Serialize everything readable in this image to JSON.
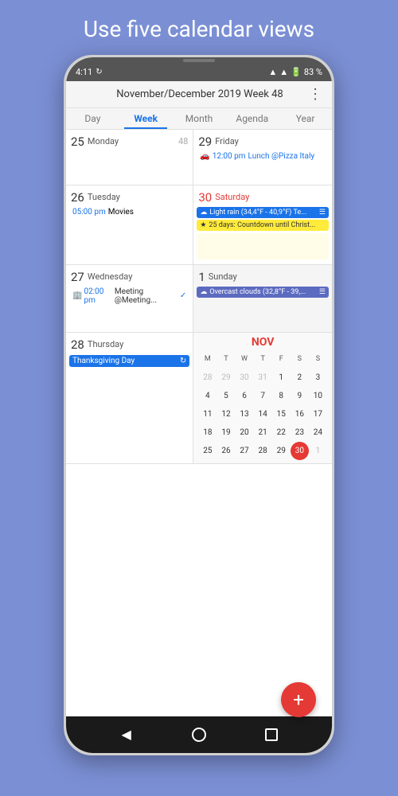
{
  "headline": "Use five calendar views",
  "statusBar": {
    "time": "4:11",
    "battery": "83 %"
  },
  "appHeader": {
    "title": "November/December 2019 Week 48",
    "menuIcon": "⋮"
  },
  "navTabs": [
    {
      "label": "Day",
      "active": false
    },
    {
      "label": "Week",
      "active": true
    },
    {
      "label": "Month",
      "active": false
    },
    {
      "label": "Agenda",
      "active": false
    },
    {
      "label": "Year",
      "active": false
    }
  ],
  "weekRows": [
    {
      "left": {
        "dayNum": "25",
        "dayName": "Monday",
        "weekNum": "48",
        "events": []
      },
      "right": {
        "dayNum": "29",
        "dayName": "Friday",
        "events": [
          {
            "type": "lunch",
            "time": "12:00 pm",
            "desc": "Lunch @Pizza Italy",
            "icon": "🚗"
          }
        ]
      }
    },
    {
      "left": {
        "dayNum": "26",
        "dayName": "Tuesday",
        "events": [
          {
            "type": "time-event",
            "time": "05:00 pm",
            "desc": "Movies"
          }
        ]
      },
      "right": {
        "dayNum": "30",
        "dayName": "Saturday",
        "isSaturday": true,
        "events": [
          {
            "type": "blue-bar",
            "icon": "☁",
            "desc": "Light rain (34,4°F - 40,9°F) Te..."
          },
          {
            "type": "star-bar",
            "icon": "★",
            "desc": "25 days: Countdown until Christ..."
          }
        ]
      }
    },
    {
      "left": {
        "dayNum": "27",
        "dayName": "Wednesday",
        "events": [
          {
            "type": "meet",
            "time": "02:00 pm",
            "desc": "Meeting @Meeting...",
            "icon": "🏢"
          }
        ]
      },
      "right": {
        "dayNum": "1",
        "dayName": "Sunday",
        "events": [
          {
            "type": "overcast",
            "icon": "☁",
            "desc": "Overcast clouds (32,8°F - 39,..."
          }
        ]
      }
    }
  ],
  "thursdayRow": {
    "dayNum": "28",
    "dayName": "Thursday",
    "event": "Thanksgiving Day"
  },
  "miniCal": {
    "month": "NOV",
    "headers": [
      "M",
      "T",
      "W",
      "T",
      "F",
      "S",
      "S"
    ],
    "rows": [
      [
        {
          "label": "28",
          "muted": true
        },
        {
          "label": "29",
          "muted": true
        },
        {
          "label": "30",
          "muted": true
        },
        {
          "label": "31",
          "muted": true
        },
        {
          "label": "1"
        },
        {
          "label": "2"
        },
        {
          "label": "3"
        }
      ],
      [
        {
          "label": "4"
        },
        {
          "label": "5"
        },
        {
          "label": "6"
        },
        {
          "label": "7"
        },
        {
          "label": "8"
        },
        {
          "label": "9"
        },
        {
          "label": "10"
        }
      ],
      [
        {
          "label": "11"
        },
        {
          "label": "12"
        },
        {
          "label": "13"
        },
        {
          "label": "14"
        },
        {
          "label": "15"
        },
        {
          "label": "16"
        },
        {
          "label": "17"
        }
      ],
      [
        {
          "label": "18"
        },
        {
          "label": "19"
        },
        {
          "label": "20"
        },
        {
          "label": "21"
        },
        {
          "label": "22"
        },
        {
          "label": "23"
        },
        {
          "label": "24"
        }
      ],
      [
        {
          "label": "25"
        },
        {
          "label": "26"
        },
        {
          "label": "27"
        },
        {
          "label": "28"
        },
        {
          "label": "29"
        },
        {
          "label": "30",
          "today": true
        },
        {
          "label": "1",
          "muted": true
        }
      ]
    ]
  },
  "fab": "+",
  "navBar": {
    "back": "◀",
    "home": "●",
    "recent": "■"
  }
}
